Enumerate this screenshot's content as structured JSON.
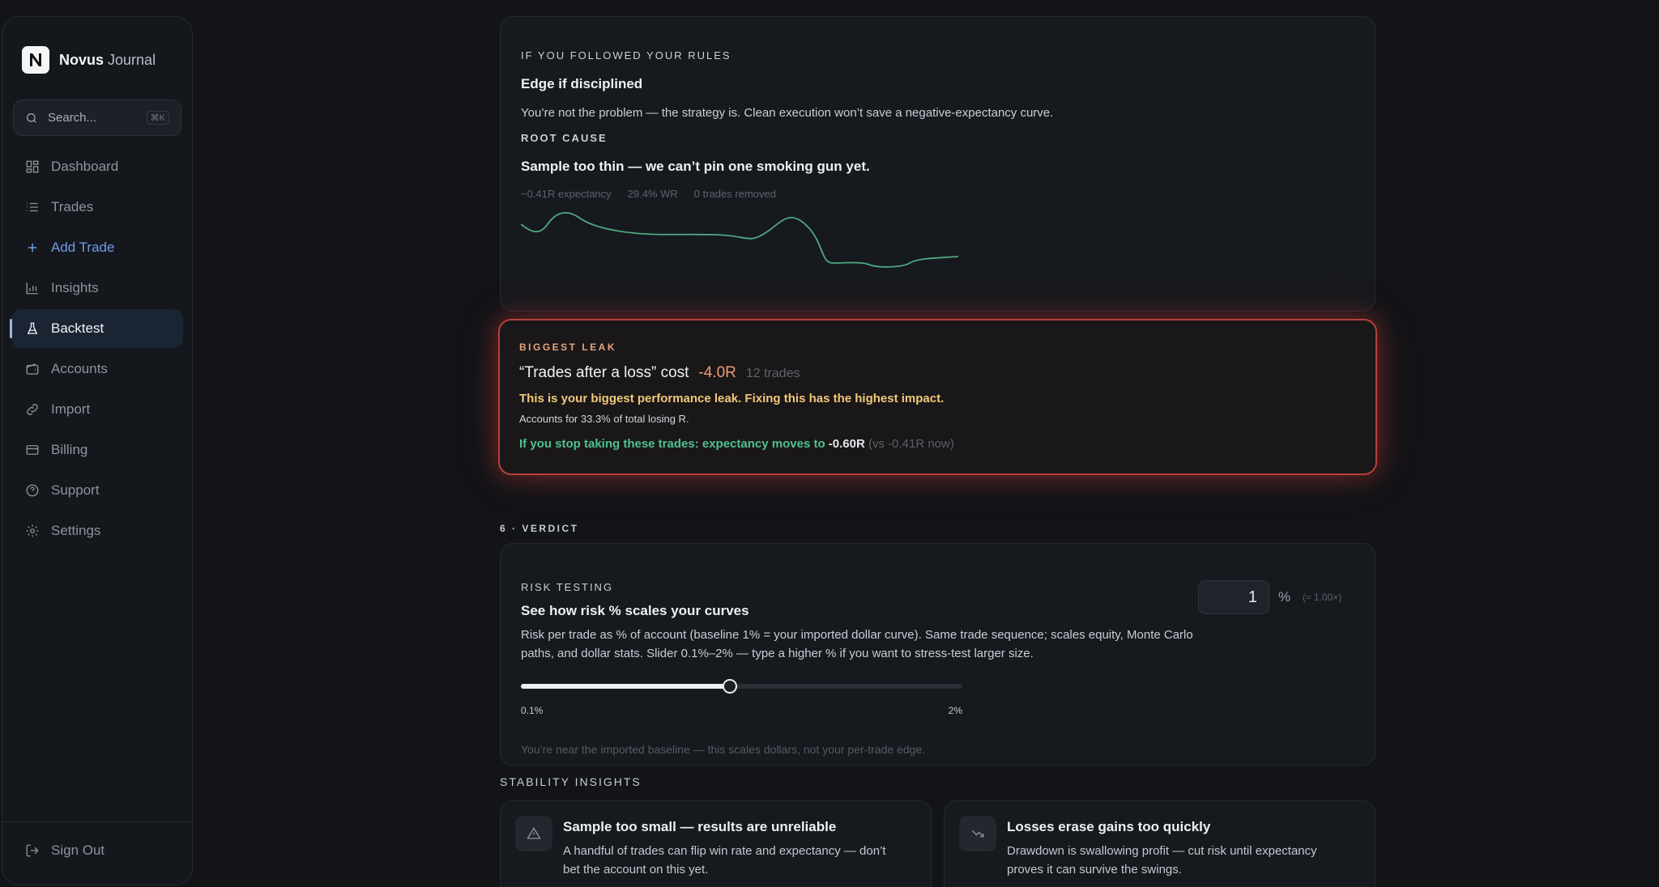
{
  "brand": {
    "name_bold": "Novus",
    "name_light": "Journal",
    "logo_letter": "N"
  },
  "search": {
    "placeholder": "Search...",
    "shortcut": "⌘K"
  },
  "nav": [
    {
      "label": "Dashboard",
      "icon": "dashboard-icon"
    },
    {
      "label": "Trades",
      "icon": "list-icon"
    },
    {
      "label": "Add Trade",
      "icon": "plus-icon"
    },
    {
      "label": "Insights",
      "icon": "bar-chart-icon"
    },
    {
      "label": "Backtest",
      "icon": "flask-icon",
      "active": true
    },
    {
      "label": "Accounts",
      "icon": "wallet-icon"
    },
    {
      "label": "Import",
      "icon": "link-icon"
    },
    {
      "label": "Billing",
      "icon": "credit-card-icon"
    },
    {
      "label": "Support",
      "icon": "help-circle-icon"
    },
    {
      "label": "Settings",
      "icon": "gear-icon"
    }
  ],
  "signout": {
    "label": "Sign Out"
  },
  "diagnosis": {
    "eyebrow": "IF YOU FOLLOWED YOUR RULES",
    "heading": "Edge if disciplined",
    "body": "You’re not the problem — the strategy is. Clean execution won’t save a negative-expectancy curve.",
    "root_label": "ROOT CAUSE",
    "root_text": "Sample too thin — we can’t pin one smoking gun yet.",
    "stats": [
      "−0.41R expectancy",
      "29.4% WR",
      "0 trades removed"
    ]
  },
  "leak": {
    "eyebrow": "BIGGEST LEAK",
    "title": "“Trades after a loss” cost",
    "cost": "-4.0R",
    "trades": "12 trades",
    "warning": "This is your biggest performance leak. Fixing this has the highest impact.",
    "accounts": "Accounts for 33.3% of total losing R.",
    "fix_prefix": "If you stop taking these trades: expectancy moves to",
    "fix_value": "-0.60R",
    "fix_vs": "(vs -0.41R now)"
  },
  "verdict": {
    "section_label": "6 · VERDICT",
    "eyebrow": "RISK TESTING",
    "heading": "See how risk % scales your curves",
    "body": "Risk per trade as % of account (baseline 1% = your imported dollar curve). Same trade sequence; scales equity, Monte Carlo paths, and dollar stats. Slider 0.1%–2% — type a higher % if you want to stress-test larger size.",
    "risk_value": "1",
    "risk_unit": "%",
    "multiplier": "(≈ 1.00×)",
    "slider_min": "0.1%",
    "slider_max": "2%",
    "slider_fraction": 0.474,
    "note": "You’re near the imported baseline — this scales dollars, not your per-trade edge."
  },
  "stability": {
    "label": "STABILITY INSIGHTS",
    "cards": [
      {
        "icon": "warning-icon",
        "title": "Sample too small — results are unreliable",
        "desc": "A handful of trades can flip win rate and expectancy — don’t bet the account on this yet."
      },
      {
        "icon": "trending-down-icon",
        "title": "Losses erase gains too quickly",
        "desc": "Drawdown is swallowing profit — cut risk until expectancy proves it can survive the swings."
      }
    ]
  },
  "colors": {
    "accent": "#6f9de6",
    "danger": "#b5403c",
    "warning": "#f1c879",
    "positive": "#4fc08f",
    "curve": "#4fa882"
  }
}
